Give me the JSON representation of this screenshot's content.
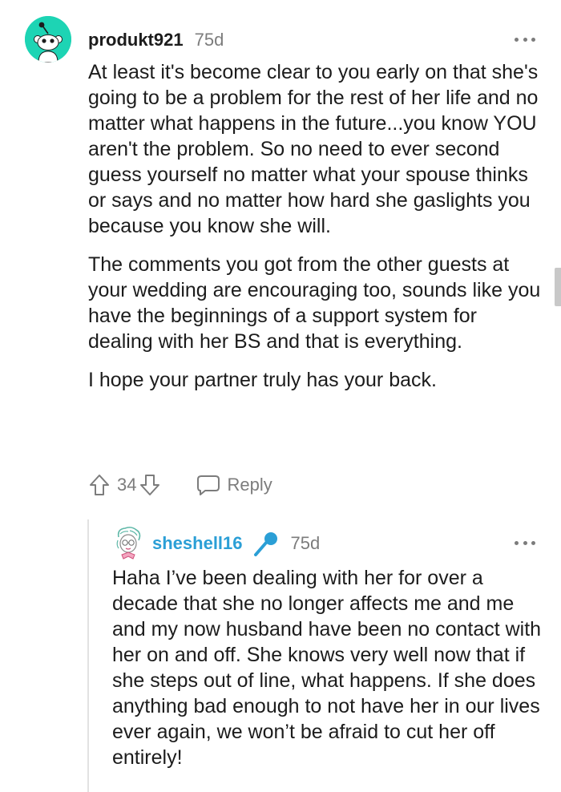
{
  "comment": {
    "username": "produkt921",
    "timestamp": "75d",
    "avatar_color": "#1dd4b4",
    "avatar_icon": "snoo-avatar-icon",
    "paragraphs": [
      "At least it's become clear to you early on that she's going to be a problem for the rest of her life and no matter what happens in the future...you know YOU aren't the problem. So no need to ever second guess yourself no matter what your spouse thinks or says and no matter how hard she gaslights you because you know she will.",
      "The comments you got from the other guests at your wedding are encouraging too, sounds like you have the beginnings of a support system for dealing with her BS and that is everything.",
      "I hope your partner truly has your back."
    ],
    "score": "34",
    "reply_label": "Reply",
    "upvote_icon": "upvote-arrow-icon",
    "downvote_icon": "downvote-arrow-icon",
    "reply_icon": "speech-bubble-icon",
    "more_icon": "more-options-icon"
  },
  "reply": {
    "username": "sheshell16",
    "username_color": "#2b9fd6",
    "timestamp": "75d",
    "badge_icon": "microphone-icon",
    "avatar_icon": "sketch-face-avatar-icon",
    "more_icon": "more-options-icon",
    "text": "Haha I’ve been dealing with her for over a decade that she no longer affects me and me and my now husband have been no contact with her on and off. She knows very well now that if she steps out of line, what happens. If she does anything bad enough to not have her in our lives ever again, we won’t be afraid to cut her off entirely!"
  },
  "colors": {
    "text": "#1c1c1c",
    "muted": "#7c7c7c",
    "thread_line": "#e2e2e2",
    "scrollbar": "#c8c8c8"
  }
}
